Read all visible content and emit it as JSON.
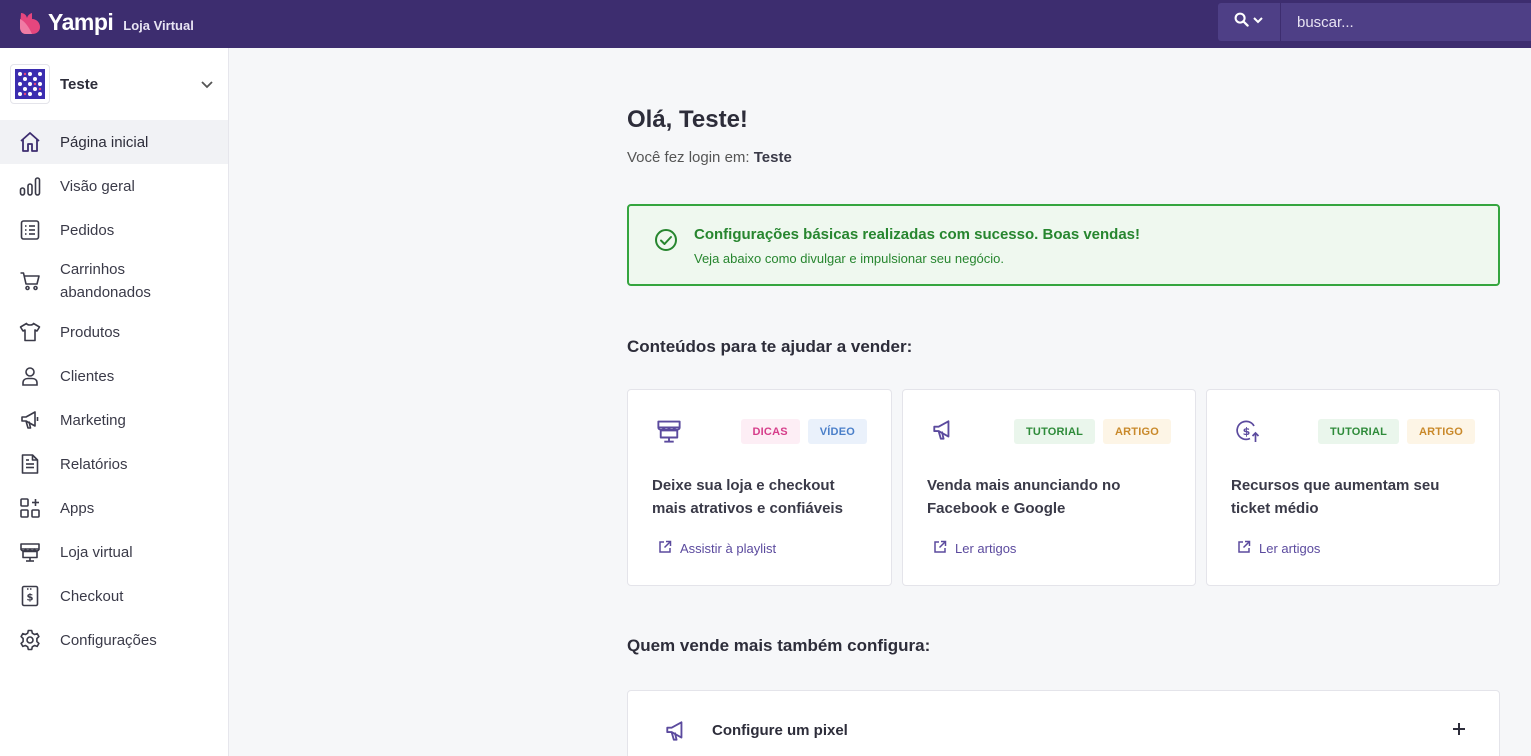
{
  "header": {
    "brand": "Yampi",
    "brand_sub": "Loja Virtual",
    "search_placeholder": "buscar...",
    "color": "#3d2d6f",
    "logo_color": "#e5467e"
  },
  "sidebar": {
    "store_name": "Teste",
    "items": [
      {
        "label": "Página inicial",
        "icon": "home-icon"
      },
      {
        "label": "Visão geral",
        "icon": "bar-chart-icon"
      },
      {
        "label": "Pedidos",
        "icon": "list-icon"
      },
      {
        "label": "Carrinhos abandonados",
        "icon": "cart-icon"
      },
      {
        "label": "Produtos",
        "icon": "tshirt-icon"
      },
      {
        "label": "Clientes",
        "icon": "user-icon"
      },
      {
        "label": "Marketing",
        "icon": "megaphone-icon"
      },
      {
        "label": "Relatórios",
        "icon": "document-icon"
      },
      {
        "label": "Apps",
        "icon": "apps-icon"
      },
      {
        "label": "Loja virtual",
        "icon": "storefront-icon"
      },
      {
        "label": "Checkout",
        "icon": "receipt-icon"
      },
      {
        "label": "Configurações",
        "icon": "gear-icon"
      }
    ]
  },
  "main": {
    "greeting": "Olá, Teste!",
    "login_prefix": "Você fez login em:",
    "login_store": "Teste",
    "alert": {
      "title": "Configurações básicas realizadas com sucesso. Boas vendas!",
      "subtitle": "Veja abaixo como divulgar e impulsionar seu negócio.",
      "color": "#35a53f"
    },
    "content_title": "Conteúdos para te ajudar a vender:",
    "cards": [
      {
        "icon": "storefront-icon",
        "tags": [
          {
            "label": "DICAS",
            "color": "#d63d8a",
            "bg": "#fdeef5"
          },
          {
            "label": "VÍDEO",
            "color": "#4a7fc9",
            "bg": "#eaf1fb"
          }
        ],
        "title": "Deixe sua loja e checkout mais atrativos e confiáveis",
        "link": "Assistir à playlist"
      },
      {
        "icon": "megaphone-icon",
        "tags": [
          {
            "label": "TUTORIAL",
            "color": "#2e8b3a",
            "bg": "#eaf6ec"
          },
          {
            "label": "ARTIGO",
            "color": "#c9892a",
            "bg": "#fdf5e6"
          }
        ],
        "title": "Venda mais anunciando no Facebook e Google",
        "link": "Ler artigos"
      },
      {
        "icon": "money-up-icon",
        "tags": [
          {
            "label": "TUTORIAL",
            "color": "#2e8b3a",
            "bg": "#eaf6ec"
          },
          {
            "label": "ARTIGO",
            "color": "#c9892a",
            "bg": "#fdf5e6"
          }
        ],
        "title": "Recursos que aumentam seu ticket médio",
        "link": "Ler artigos"
      }
    ],
    "config_title": "Quem vende mais também configura:",
    "accordion": [
      {
        "icon": "megaphone-icon",
        "title": "Configure um pixel"
      }
    ]
  }
}
